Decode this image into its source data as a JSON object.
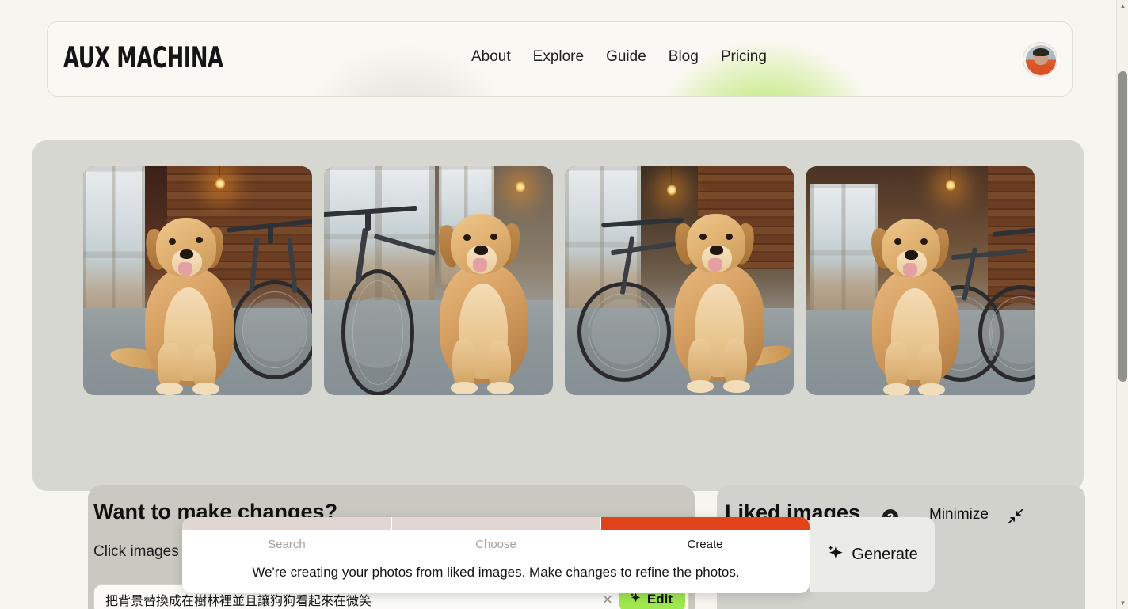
{
  "header": {
    "logo": "AUX MACHINA",
    "nav": [
      {
        "label": "About"
      },
      {
        "label": "Explore"
      },
      {
        "label": "Guide"
      },
      {
        "label": "Blog"
      },
      {
        "label": "Pricing"
      }
    ],
    "accent_glow_color": "#a9e34b"
  },
  "gallery": {
    "images": [
      {
        "alt": "Golden retriever sitting by cabin window with bicycle"
      },
      {
        "alt": "Golden retriever sitting beside bicycle in sunlit room"
      },
      {
        "alt": "Golden retriever sitting in front of bicycle in wooden kitchen"
      },
      {
        "alt": "Golden retriever sitting beside bicycle in wooden cabin interior"
      }
    ]
  },
  "changes": {
    "title": "Want to make changes?",
    "subtitle": "Click images",
    "prompt_value": "把背景替換成在樹林裡並且讓狗狗看起來在微笑",
    "prompt_placeholder": "",
    "clear_label": "✕",
    "edit_label": "Edit"
  },
  "liked": {
    "title": "Liked images",
    "help_label": "?",
    "minimize_label": "Minimize"
  },
  "overlay": {
    "steps": [
      {
        "label": "Search",
        "state": "pending"
      },
      {
        "label": "Choose",
        "state": "pending"
      },
      {
        "label": "Create",
        "state": "active"
      }
    ],
    "message": "We're creating your photos from liked images. Make changes to refine the photos.",
    "progress_fill_color": "#e1441a",
    "progress_track_color": "#e2d6d2"
  },
  "generate": {
    "label": "Generate"
  },
  "scrollbar": {
    "up_label": "▲",
    "down_label": "▼"
  }
}
